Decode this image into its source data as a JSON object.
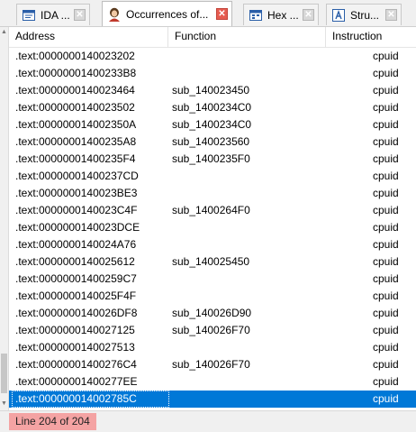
{
  "tabs": [
    {
      "label": "IDA ...",
      "icon": "ida-view-icon",
      "active": false
    },
    {
      "label": "Occurrences of...",
      "icon": "occurrences-person-icon",
      "active": true
    },
    {
      "label": "Hex ...",
      "icon": "hex-view-icon",
      "active": false
    },
    {
      "label": "Stru...",
      "icon": "structures-icon",
      "active": false
    }
  ],
  "close_glyph": "✕",
  "table": {
    "headers": {
      "address": "Address",
      "function": "Function",
      "instruction": "Instruction"
    },
    "rows": [
      {
        "address": ".text:0000000140023202",
        "function": "",
        "instruction": "cpuid"
      },
      {
        "address": ".text:00000001400233B8",
        "function": "",
        "instruction": "cpuid"
      },
      {
        "address": ".text:0000000140023464",
        "function": "sub_140023450",
        "instruction": "cpuid"
      },
      {
        "address": ".text:0000000140023502",
        "function": "sub_1400234C0",
        "instruction": "cpuid"
      },
      {
        "address": ".text:000000014002350A",
        "function": "sub_1400234C0",
        "instruction": "cpuid"
      },
      {
        "address": ".text:00000001400235A8",
        "function": "sub_140023560",
        "instruction": "cpuid"
      },
      {
        "address": ".text:00000001400235F4",
        "function": "sub_1400235F0",
        "instruction": "cpuid"
      },
      {
        "address": ".text:00000001400237CD",
        "function": "",
        "instruction": "cpuid"
      },
      {
        "address": ".text:0000000140023BE3",
        "function": "",
        "instruction": "cpuid"
      },
      {
        "address": ".text:0000000140023C4F",
        "function": "sub_1400264F0",
        "instruction": "cpuid"
      },
      {
        "address": ".text:0000000140023DCE",
        "function": "",
        "instruction": "cpuid"
      },
      {
        "address": ".text:0000000140024A76",
        "function": "",
        "instruction": "cpuid"
      },
      {
        "address": ".text:0000000140025612",
        "function": "sub_140025450",
        "instruction": "cpuid"
      },
      {
        "address": ".text:00000001400259C7",
        "function": "",
        "instruction": "cpuid"
      },
      {
        "address": ".text:0000000140025F4F",
        "function": "",
        "instruction": "cpuid"
      },
      {
        "address": ".text:0000000140026DF8",
        "function": "sub_140026D90",
        "instruction": "cpuid"
      },
      {
        "address": ".text:0000000140027125",
        "function": "sub_140026F70",
        "instruction": "cpuid"
      },
      {
        "address": ".text:0000000140027513",
        "function": "",
        "instruction": "cpuid"
      },
      {
        "address": ".text:00000001400276C4",
        "function": "sub_140026F70",
        "instruction": "cpuid"
      },
      {
        "address": ".text:00000001400277EE",
        "function": "",
        "instruction": "cpuid"
      },
      {
        "address": ".text:000000014002785C",
        "function": "",
        "instruction": "cpuid",
        "selected": true
      }
    ]
  },
  "status": {
    "text": "Line 204 of 204",
    "highlight_color": "#f4a3a3"
  },
  "colors": {
    "selection": "#0078d7",
    "active_close": "#e65c50"
  }
}
